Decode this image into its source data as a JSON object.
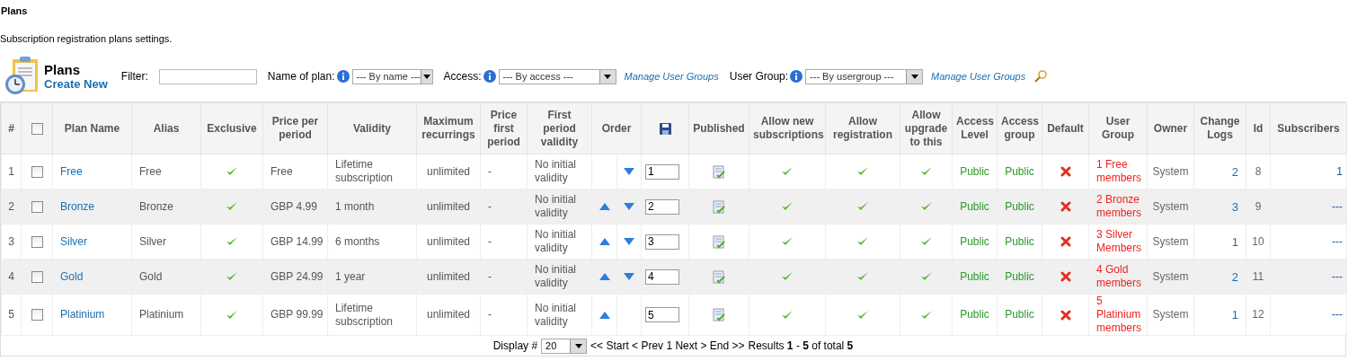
{
  "page": {
    "title": "Plans",
    "description": "Subscription registration plans settings."
  },
  "toolbar": {
    "title": "Plans",
    "create_link": "Create New",
    "filter_label": "Filter:",
    "name_filter": {
      "label": "Name of plan:",
      "value": "--- By name ---"
    },
    "access_filter": {
      "label": "Access:",
      "value": "--- By access ---",
      "link": "Manage User Groups"
    },
    "usergroup_filter": {
      "label": "User Group:",
      "value": "--- By usergroup ---",
      "link": "Manage User Groups"
    }
  },
  "table": {
    "select_all_checked": false,
    "columns": [
      "#",
      "Plan Name",
      "Alias",
      "Exclusive",
      "Price per period",
      "Validity",
      "Maximum recurrings",
      "Price first period",
      "First period validity",
      "Order",
      "Published",
      "Allow new subscriptions",
      "Allow registration",
      "Allow upgrade to this",
      "Access Level",
      "Access group",
      "Default",
      "User Group",
      "Owner",
      "Change Logs",
      "Id",
      "Subscribers"
    ],
    "rows": [
      {
        "num": "1",
        "checked": false,
        "name": "Free",
        "alias": "Free",
        "exclusive": true,
        "price": "Free",
        "validity": "Lifetime subscription",
        "max_recurrings": "unlimited",
        "price_first": "-",
        "first_validity": "No initial validity",
        "can_move_up": false,
        "can_move_down": true,
        "order": "1",
        "published": true,
        "allow_new": true,
        "allow_registration": true,
        "allow_upgrade": true,
        "access_level": "Public",
        "access_group": "Public",
        "default": false,
        "user_group": "1 Free members",
        "owner": "System",
        "change_logs": "2",
        "id": "8",
        "subscribers": "1"
      },
      {
        "num": "2",
        "checked": false,
        "name": "Bronze",
        "alias": "Bronze",
        "exclusive": true,
        "price": "GBP 4.99",
        "validity": "1 month",
        "max_recurrings": "unlimited",
        "price_first": "-",
        "first_validity": "No initial validity",
        "can_move_up": true,
        "can_move_down": true,
        "order": "2",
        "published": true,
        "allow_new": true,
        "allow_registration": true,
        "allow_upgrade": true,
        "access_level": "Public",
        "access_group": "Public",
        "default": false,
        "user_group": "2 Bronze members",
        "owner": "System",
        "change_logs": "3",
        "id": "9",
        "subscribers": "---"
      },
      {
        "num": "3",
        "checked": false,
        "name": "Silver",
        "alias": "Silver",
        "exclusive": true,
        "price": "GBP 14.99",
        "validity": "6 months",
        "max_recurrings": "unlimited",
        "price_first": "-",
        "first_validity": "No initial validity",
        "can_move_up": true,
        "can_move_down": true,
        "order": "3",
        "published": true,
        "allow_new": true,
        "allow_registration": true,
        "allow_upgrade": true,
        "access_level": "Public",
        "access_group": "Public",
        "default": false,
        "user_group": "3 Silver Members",
        "owner": "System",
        "change_logs": "1",
        "id": "10",
        "subscribers": "---"
      },
      {
        "num": "4",
        "checked": false,
        "name": "Gold",
        "alias": "Gold",
        "exclusive": true,
        "price": "GBP 24.99",
        "validity": "1 year",
        "max_recurrings": "unlimited",
        "price_first": "-",
        "first_validity": "No initial validity",
        "can_move_up": true,
        "can_move_down": true,
        "order": "4",
        "published": true,
        "allow_new": true,
        "allow_registration": true,
        "allow_upgrade": true,
        "access_level": "Public",
        "access_group": "Public",
        "default": false,
        "user_group": "4 Gold members",
        "owner": "System",
        "change_logs": "2",
        "id": "11",
        "subscribers": "---"
      },
      {
        "num": "5",
        "checked": false,
        "name": "Platinium",
        "alias": "Platinium",
        "exclusive": true,
        "price": "GBP 99.99",
        "validity": "Lifetime subscription",
        "max_recurrings": "unlimited",
        "price_first": "-",
        "first_validity": "No initial validity",
        "can_move_up": true,
        "can_move_down": false,
        "order": "5",
        "published": true,
        "allow_new": true,
        "allow_registration": true,
        "allow_upgrade": true,
        "access_level": "Public",
        "access_group": "Public",
        "default": false,
        "user_group": "5 Platinium members",
        "owner": "System",
        "change_logs": "1",
        "id": "12",
        "subscribers": "---"
      }
    ]
  },
  "pagination": {
    "display_label": "Display #",
    "display_value": "20",
    "nav": "<< Start < Prev 1 Next > End >>",
    "results": "Results **1** - **5** of total **5**"
  }
}
